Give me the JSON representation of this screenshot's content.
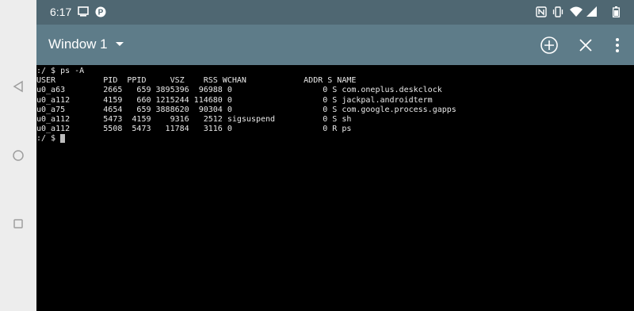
{
  "status_bar": {
    "time": "6:17",
    "left_icons": [
      "screen-mirror-icon",
      "parking-icon"
    ],
    "right_icons": [
      "nfc-icon",
      "vibrate-icon",
      "wifi-icon",
      "signal-icon",
      "battery-icon"
    ],
    "background": "#4f6772"
  },
  "toolbar": {
    "window_title": "Window 1",
    "background": "#5e7c89",
    "actions": [
      "new-window-icon",
      "close-window-icon",
      "overflow-menu-icon"
    ]
  },
  "terminal": {
    "prompt_line": ":/ $ ps -A",
    "header": "USER          PID  PPID     VSZ    RSS WCHAN            ADDR S NAME",
    "rows": [
      "u0_a63        2665   659 3895396  96988 0                   0 S com.oneplus.deskclock",
      "u0_a112       4159   660 1215244 114680 0                   0 S jackpal.androidterm",
      "u0_a75        4654   659 3888620  90304 0                   0 S com.google.process.gapps",
      "u0_a112       5473  4159    9316   2512 sigsuspend          0 S sh",
      "u0_a112       5508  5473   11784   3116 0                   0 R ps"
    ],
    "final_prompt": ":/ $ ",
    "text_color": "#e8e8e8",
    "background": "#000000"
  },
  "nav_bar": {
    "buttons": [
      "back-icon",
      "home-icon",
      "recents-icon"
    ]
  }
}
